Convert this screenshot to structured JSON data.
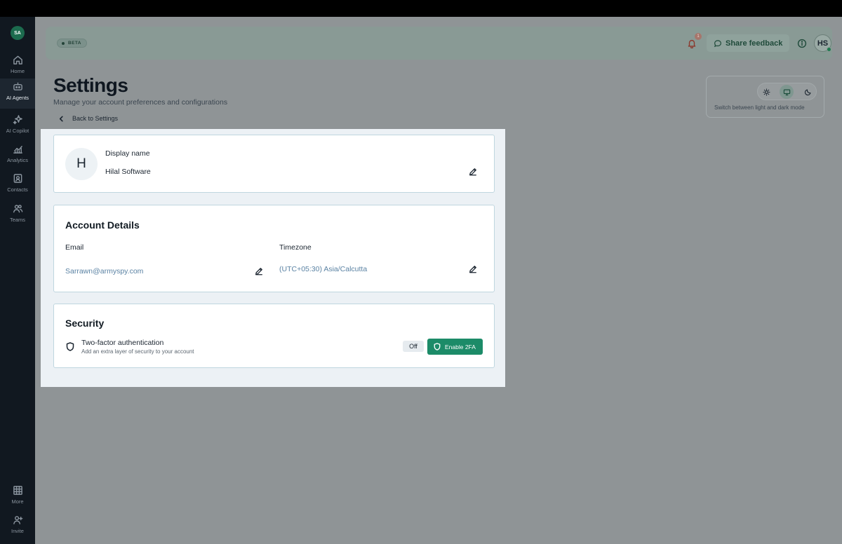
{
  "sidebar": {
    "workspace_avatar": "SA",
    "items": [
      {
        "label": "Home",
        "icon": "home-icon"
      },
      {
        "label": "AI Agents",
        "icon": "robot-icon",
        "active": true
      },
      {
        "label": "AI Copilot",
        "icon": "sparkles-icon"
      },
      {
        "label": "Analytics",
        "icon": "chart-icon"
      },
      {
        "label": "Contacts",
        "icon": "contact-card-icon"
      },
      {
        "label": "Teams",
        "icon": "users-icon"
      }
    ],
    "bottom_items": [
      {
        "label": "More",
        "icon": "grid-icon"
      },
      {
        "label": "Invite",
        "icon": "user-plus-icon"
      }
    ]
  },
  "header": {
    "badge": "BETA",
    "notification_count": "1",
    "feedback_label": "Share feedback",
    "user_initials": "HS"
  },
  "page": {
    "title": "Settings",
    "subtitle": "Manage your account preferences and configurations",
    "back_label": "Back to Settings"
  },
  "theme": {
    "caption": "Switch between light and dark mode",
    "options": [
      "light",
      "system",
      "dark"
    ],
    "selected": "system"
  },
  "profile": {
    "avatar_initial": "H",
    "display_name_label": "Display name",
    "display_name": "Hilal Software"
  },
  "account": {
    "title": "Account Details",
    "email_label": "Email",
    "email": "Sarrawn@armyspy.com",
    "timezone_label": "Timezone",
    "timezone": "(UTC+05:30) Asia/Calcutta"
  },
  "security": {
    "title": "Security",
    "tfa_title": "Two-factor authentication",
    "tfa_description": "Add an extra layer of security to your account",
    "status": "Off",
    "enable_label": "Enable 2FA"
  },
  "colors": {
    "accent": "#1c8b68",
    "sidebar_bg": "#111820",
    "overlay_bg": "#8f9496"
  }
}
